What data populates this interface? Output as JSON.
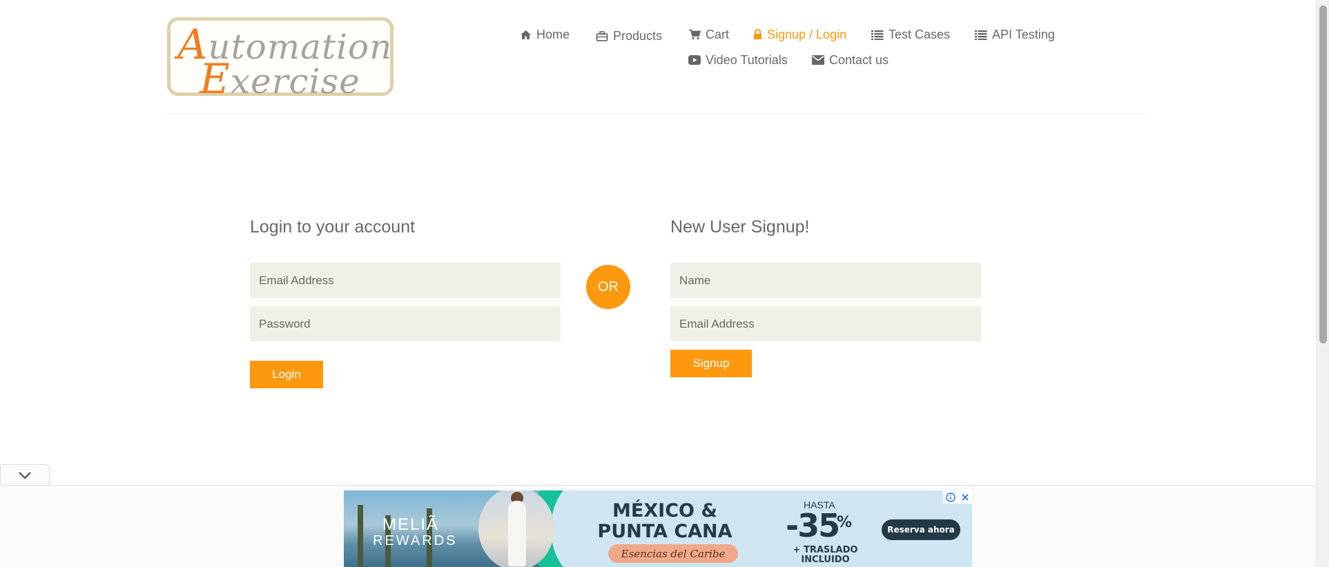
{
  "brand": {
    "line1_cap": "A",
    "line1_rest": "utomation",
    "line2_cap": "E",
    "line2_rest": "xercise"
  },
  "nav": {
    "home": "Home",
    "products": "Products",
    "cart": "Cart",
    "signup_login": "Signup / Login",
    "test_cases": "Test Cases",
    "api_testing": "API Testing",
    "video_tutorials": "Video Tutorials",
    "contact_us": "Contact us"
  },
  "login": {
    "title": "Login to your account",
    "email_placeholder": "Email Address",
    "password_placeholder": "Password",
    "button": "Login"
  },
  "or_label": "OR",
  "signup": {
    "title": "New User Signup!",
    "name_placeholder": "Name",
    "email_placeholder": "Email Address",
    "button": "Signup"
  },
  "ad": {
    "brand_line1": "MELIÃ",
    "brand_line2": "REWARDS",
    "headline": "MÉXICO & PUNTA CANA",
    "tagline": "Esencias del Caribe",
    "hasta": "HASTA",
    "discount": "-35",
    "percent": "%",
    "extra": "+ TRASLADO INCLUIDO",
    "cta": "Reserva ahora"
  },
  "colors": {
    "accent": "#fe980f",
    "text": "#696763",
    "field_bg": "#f0f0e9"
  }
}
